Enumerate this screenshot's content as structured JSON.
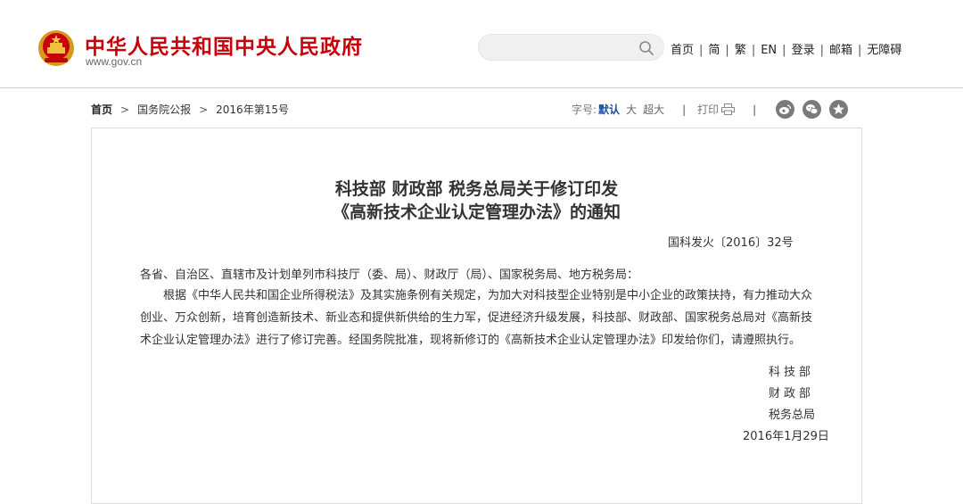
{
  "header": {
    "site_title": "中华人民共和国中央人民政府",
    "site_url": "www.gov.cn",
    "search_placeholder": "",
    "nav": [
      "首页",
      "简",
      "繁",
      "EN",
      "登录",
      "邮箱",
      "无障碍"
    ]
  },
  "breadcrumb": {
    "home": "首页",
    "level1": "国务院公报",
    "level2": "2016年第15号"
  },
  "toolbar": {
    "font_size_label": "字号:",
    "font_default": "默认",
    "font_large": "大",
    "font_xlarge": "超大",
    "print_label": "打印",
    "share_icons": [
      "weibo-icon",
      "wechat-icon",
      "favorite-icon"
    ]
  },
  "document": {
    "title_line1": "科技部 财政部 税务总局关于修订印发",
    "title_line2": "《高新技术企业认定管理办法》的通知",
    "doc_number": "国科发火〔2016〕32号",
    "addressee": "各省、自治区、直辖市及计划单列市科技厅（委、局）、财政厅（局）、国家税务局、地方税务局：",
    "body": "根据《中华人民共和国企业所得税法》及其实施条例有关规定，为加大对科技型企业特别是中小企业的政策扶持，有力推动大众创业、万众创新，培育创造新技术、新业态和提供新供给的生力军，促进经济升级发展，科技部、财政部、国家税务总局对《高新技术企业认定管理办法》进行了修订完善。经国务院批准，现将新修订的《高新技术企业认定管理办法》印发给你们，请遵照执行。",
    "signers": [
      "科技部",
      "财政部",
      "税务总局"
    ],
    "date": "2016年1月29日"
  },
  "colors": {
    "brand_red": "#c8000b",
    "link_blue": "#1a4fa0"
  }
}
